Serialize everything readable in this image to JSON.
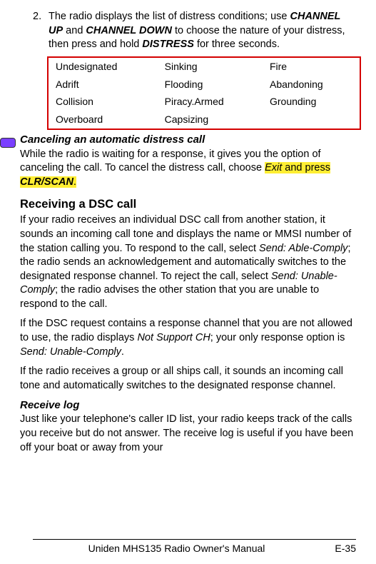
{
  "step": {
    "num": "2.",
    "pre": "The radio displays the list of distress conditions; use ",
    "chup": "CHANNEL UP",
    "mid1": " and ",
    "chdn": "CHANNEL DOWN",
    "mid2": " to choose the nature of your distress, then press and hold ",
    "distress": "DISTRESS",
    "post": " for three seconds."
  },
  "table": {
    "r0c0": "Undesignated",
    "r0c1": "Sinking",
    "r0c2": "Fire",
    "r1c0": "Adrift",
    "r1c1": "Flooding",
    "r1c2": "Abandoning",
    "r2c0": "Collision",
    "r2c1": "Piracy.Armed",
    "r2c2": "Grounding",
    "r3c0": "Overboard",
    "r3c1": "Capsizing",
    "r3c2": ""
  },
  "cancel": {
    "heading": "Canceling an automatic distress call",
    "p_pre": "While the radio is waiting for a response, it gives you the option of canceling the call. To cancel the distress call, choose ",
    "exit": "Exit",
    "p_mid": " and press ",
    "clr": "CLR/SCAN",
    "p_post": "."
  },
  "dsc": {
    "heading": "Receiving a DSC call",
    "p1a": "If your radio receives an individual DSC call from another station, it sounds an incoming call tone and displays the name or MMSI number of the station calling you. To respond to the call, select ",
    "send_able": "Send: Able-Comply",
    "p1b": "; the radio sends an acknowledgement and automatically switches to the designated response channel. To reject the call, select ",
    "send_unable": "Send: Unable-Comply",
    "p1c": "; the radio advises the other station that you are unable to respond to the call.",
    "p2a": "If the DSC request contains a response channel that you are not allowed to use, the radio displays ",
    "not_support": "Not Support CH",
    "p2b": "; your only response option is ",
    "send_unable2": "Send: Unable-Comply",
    "p2c": ".",
    "p3": "If the radio receives a group or all ships call, it sounds an incoming call tone and automatically switches to the designated response channel."
  },
  "recvlog": {
    "heading": "Receive log",
    "p": "Just like your telephone's caller ID list, your radio keeps track of the calls you receive but do not answer. The receive log is useful if you have been off your boat or away from your"
  },
  "footer": {
    "center": "Uniden MHS135 Radio Owner's Manual",
    "right": "E-35"
  }
}
